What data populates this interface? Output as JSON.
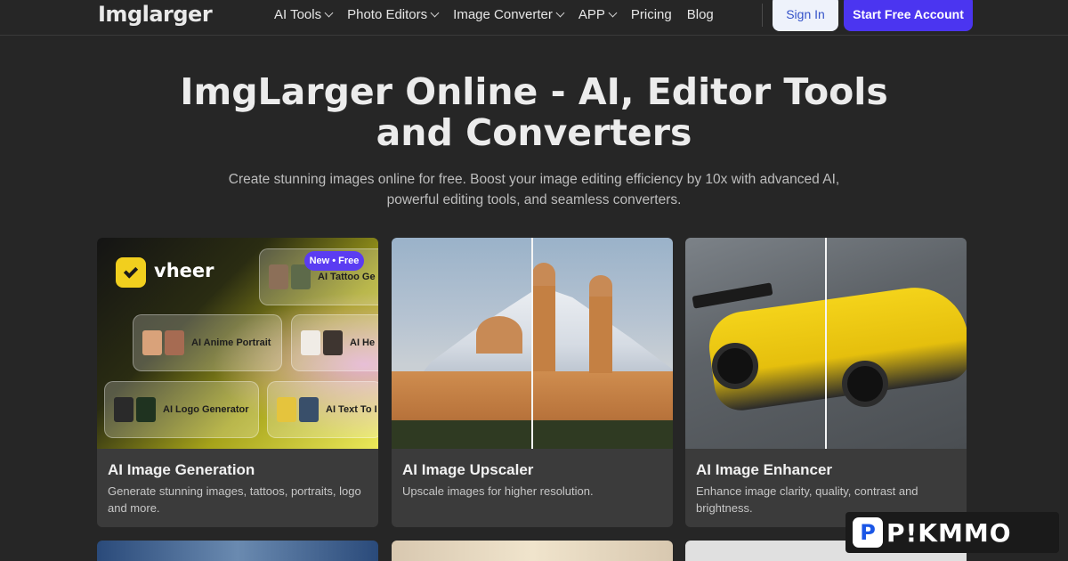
{
  "brand": {
    "logo_text": "Imglarger"
  },
  "nav": {
    "items": [
      {
        "label": "AI Tools",
        "has_dropdown": true
      },
      {
        "label": "Photo Editors",
        "has_dropdown": true
      },
      {
        "label": "Image Converter",
        "has_dropdown": true
      },
      {
        "label": "APP",
        "has_dropdown": true
      },
      {
        "label": "Pricing",
        "has_dropdown": false
      },
      {
        "label": "Blog",
        "has_dropdown": false
      }
    ],
    "sign_in_label": "Sign In",
    "start_label": "Start Free Account"
  },
  "hero": {
    "title_line1": "ImgLarger Online - AI, Editor Tools",
    "title_line2": "and Converters",
    "subtitle_line1": "Create stunning images online for free. Boost your image editing efficiency by 10x with advanced AI,",
    "subtitle_line2": "powerful editing tools, and seamless converters."
  },
  "cards": [
    {
      "title": "AI Image Generation",
      "description": "Generate stunning images, tattoos, portraits, logo and more.",
      "promo": {
        "brand": "vheer",
        "badge": "New • Free",
        "tiles": [
          "AI Tattoo Ge",
          "AI Anime Portrait",
          "AI He",
          "AI Logo Generator",
          "AI Text To I"
        ]
      }
    },
    {
      "title": "AI Image Upscaler",
      "description": "Upscale images for higher resolution."
    },
    {
      "title": "AI Image Enhancer",
      "description": "Enhance image clarity, quality, contrast and brightness."
    }
  ],
  "watermark": {
    "letter": "P",
    "text": "P!KMMO"
  },
  "colors": {
    "background": "#262626",
    "accent": "#4b35f0",
    "card": "#3b3b3b",
    "signin_bg": "#eef2fb"
  }
}
